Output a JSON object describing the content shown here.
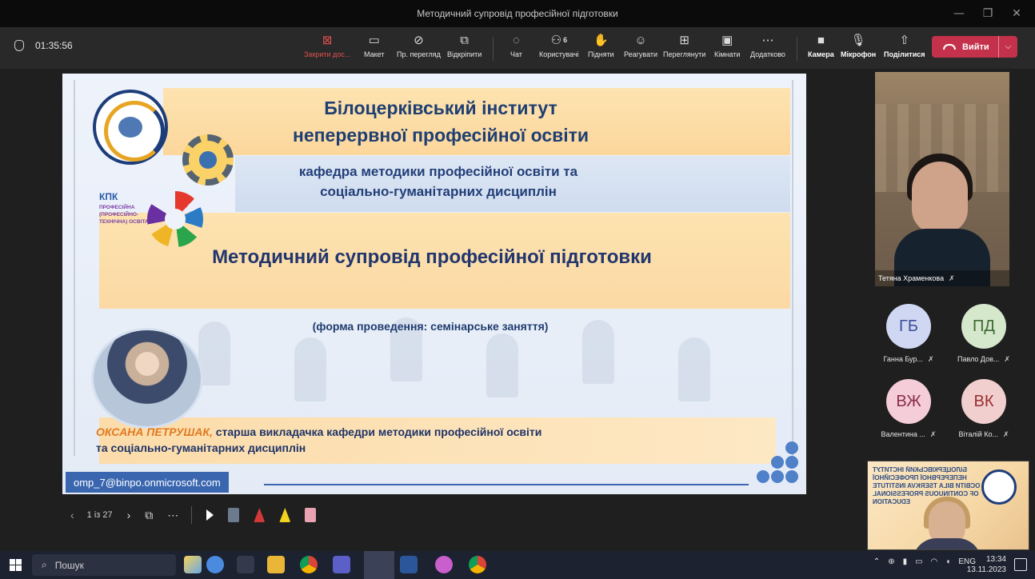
{
  "window": {
    "title": "Методичний супровід професійної підготовки",
    "controls": [
      "—",
      "❐",
      "✕"
    ]
  },
  "meeting": {
    "timer": "01:35:56",
    "buttons": [
      {
        "id": "close-share",
        "label": "Закрити дос...",
        "icon": "close-share-icon",
        "glyph": "⊠",
        "color": "#e24f4f"
      },
      {
        "id": "layout",
        "label": "Макет",
        "icon": "layout-icon",
        "glyph": "▭"
      },
      {
        "id": "pr-view",
        "label": "Пр. перегляд",
        "icon": "eye-off-icon",
        "glyph": "⊘"
      },
      {
        "id": "popout",
        "label": "Відкріпити",
        "icon": "popout-icon",
        "glyph": "⧉"
      },
      {
        "id": "chat",
        "label": "Чат",
        "icon": "chat-icon",
        "glyph": "◌"
      },
      {
        "id": "people",
        "label": "Користувачі",
        "icon": "people-icon",
        "glyph": "⚇",
        "count": "6"
      },
      {
        "id": "raise",
        "label": "Підняти",
        "icon": "hand-icon",
        "glyph": "✋"
      },
      {
        "id": "react",
        "label": "Реагувати",
        "icon": "smile-icon",
        "glyph": "☺"
      },
      {
        "id": "view",
        "label": "Переглянути",
        "icon": "grid-icon",
        "glyph": "⊞"
      },
      {
        "id": "rooms",
        "label": "Кімнати",
        "icon": "rooms-icon",
        "glyph": "▣"
      },
      {
        "id": "more",
        "label": "Додатково",
        "icon": "more-icon",
        "glyph": "⋯"
      },
      {
        "id": "camera",
        "label": "Камера",
        "icon": "camera-icon",
        "glyph": "■"
      },
      {
        "id": "mic",
        "label": "Мікрофон",
        "icon": "microphone-icon",
        "glyph": "🎙"
      },
      {
        "id": "share",
        "label": "Поділитися",
        "icon": "share-icon",
        "glyph": "⇧"
      }
    ],
    "leave_label": "Вийти"
  },
  "slide": {
    "title_line1": "Білоцерківський інститут",
    "title_line2": "неперервної професійної освіти",
    "dept_line1": "кафедра методики професійної освіти та",
    "dept_line2": "соціально-гуманітарних дисциплін",
    "topic": "Методичний супровід професійної підготовки",
    "form": "(форма проведення: семінарське заняття)",
    "author_name": "ОКСАНА ПЕТРУШАК,",
    "author_rest_line1": " старша викладачка кафедри методики професійної освіти",
    "author_line2": "та соціально-гуманітарних дисциплін",
    "email": "omp_7@binpo.onmicrosoft.com",
    "logo3_kpk": "КПК",
    "logo3_text": "ПРОФЕСІЙНА (ПРОФЕСІЙНО-ТЕХНІЧНА) ОСВІТА"
  },
  "slide_nav": {
    "prev": "‹",
    "page": "1 із 27",
    "next": "›",
    "grid_glyph": "⧉",
    "more": "⋯"
  },
  "participants": {
    "video_name": "Тетяна Храменкова",
    "tiles": [
      {
        "initials": "ГБ",
        "name": "Ганна Бур...",
        "bg": "#cfd7f2",
        "fg": "#3a4f97"
      },
      {
        "initials": "ПД",
        "name": "Павло Дов...",
        "bg": "#d6e8cc",
        "fg": "#3d6a33"
      },
      {
        "initials": "ВЖ",
        "name": "Валентина ...",
        "bg": "#f4cdd8",
        "fg": "#8d2b4a"
      },
      {
        "initials": "ВК",
        "name": "Віталій Ко...",
        "bg": "#f2cfcf",
        "fg": "#9a2f2f"
      }
    ],
    "selfview_text": "БІЛОЦЕРКІВСЬКИЙ ІНСТИТУТ НЕПЕРЕРВНОЇ ПРОФЕСІЙНОЇ ОСВІТИ BILA TSERKVA INSTITUTE OF CONTINUOUS PROFESSIONAL EDUCATION"
  },
  "taskbar": {
    "search_label": "Пошук",
    "lang": "ENG",
    "time": "13:34",
    "date": "13.11.2023"
  }
}
